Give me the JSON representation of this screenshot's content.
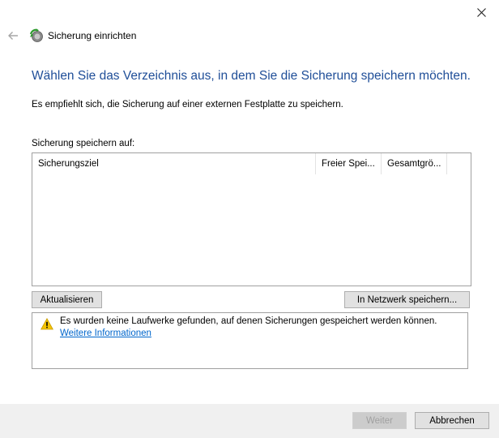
{
  "window": {
    "title": "Sicherung einrichten",
    "close_icon": "close-icon",
    "back_icon": "back-arrow-icon",
    "app_icon": "backup-icon"
  },
  "main": {
    "heading": "Wählen Sie das Verzeichnis aus, in dem Sie die Sicherung speichern möchten.",
    "intro": "Es empfiehlt sich, die Sicherung auf einer externen Festplatte zu speichern.",
    "list_label": "Sicherung speichern auf:",
    "columns": [
      "Sicherungsziel",
      "Freier Spei...",
      "Gesamtgrö..."
    ],
    "rows": []
  },
  "buttons": {
    "refresh": "Aktualisieren",
    "network": "In Netzwerk speichern...",
    "next": "Weiter",
    "cancel": "Abbrechen"
  },
  "info": {
    "icon": "warning-icon",
    "message": "Es wurden keine Laufwerke gefunden, auf denen Sicherungen gespeichert werden können.",
    "link": "Weitere Informationen"
  },
  "colors": {
    "heading": "#1f4e98",
    "link": "#0066cc",
    "footer": "#f0f0f0"
  }
}
